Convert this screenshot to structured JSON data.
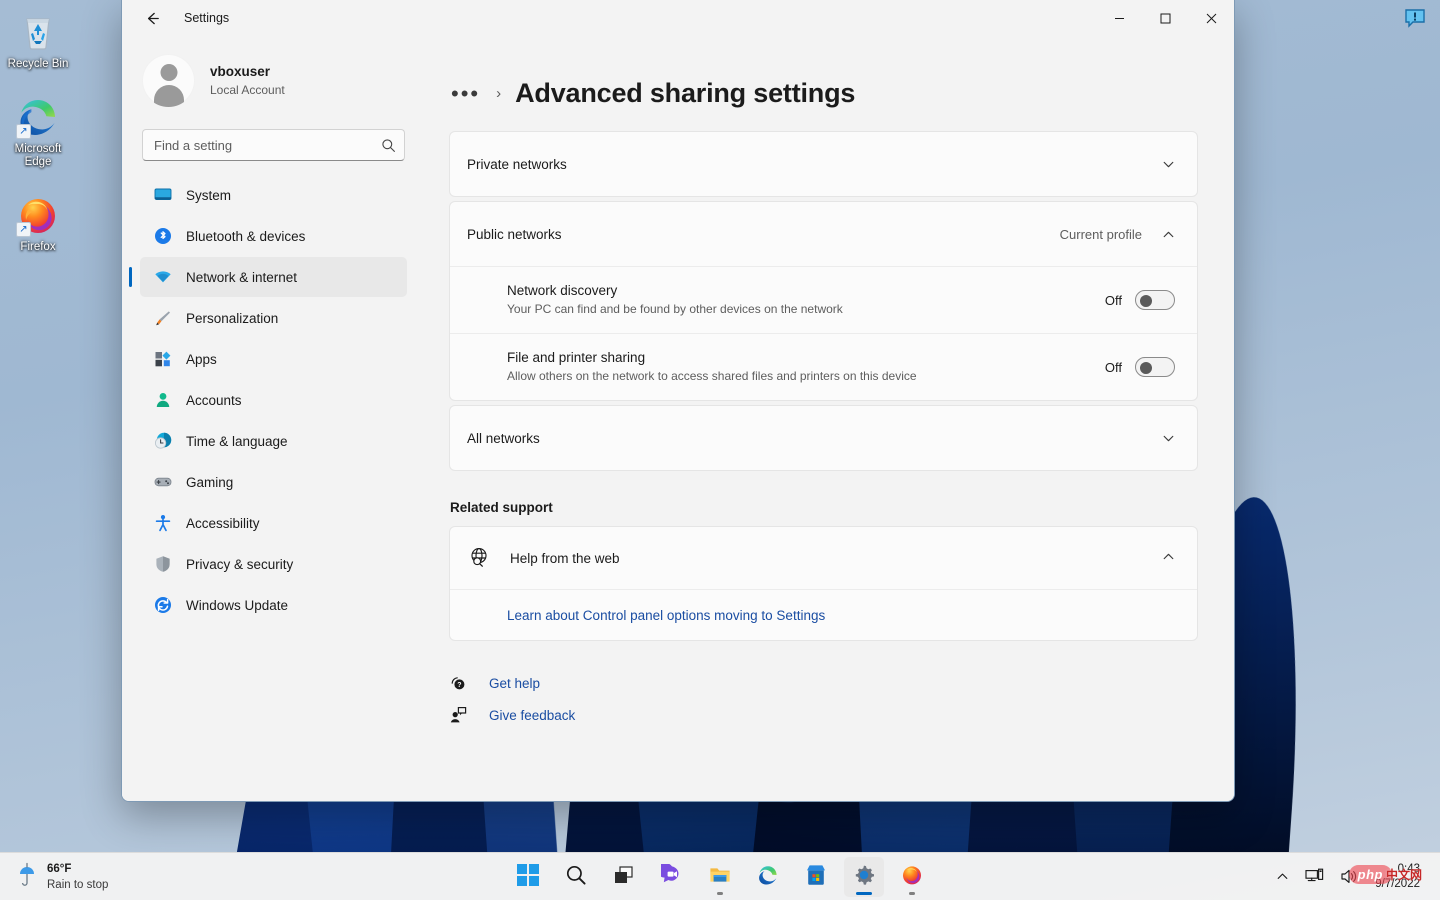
{
  "desktop": {
    "icons": [
      {
        "label": "Recycle Bin",
        "icon": "recycle-bin-icon",
        "shortcut": false
      },
      {
        "label": "Microsoft Edge",
        "icon": "edge-icon",
        "shortcut": true
      },
      {
        "label": "Firefox",
        "icon": "firefox-icon",
        "shortcut": true
      }
    ],
    "notification_balloon": "notification-balloon-icon"
  },
  "window": {
    "title": "Settings",
    "back_icon": "back-arrow-icon",
    "controls": {
      "minimize": "minimize-icon",
      "maximize": "maximize-icon",
      "close": "close-icon"
    }
  },
  "sidebar": {
    "account": {
      "name": "vboxuser",
      "subtitle": "Local Account",
      "avatar": "user-avatar"
    },
    "search": {
      "placeholder": "Find a setting",
      "value": "",
      "icon": "search-icon"
    },
    "items": [
      {
        "label": "System",
        "icon": "system-icon",
        "active": false
      },
      {
        "label": "Bluetooth & devices",
        "icon": "bluetooth-icon",
        "active": false
      },
      {
        "label": "Network & internet",
        "icon": "network-wifi-icon",
        "active": true
      },
      {
        "label": "Personalization",
        "icon": "personalization-brush-icon",
        "active": false
      },
      {
        "label": "Apps",
        "icon": "apps-icon",
        "active": false
      },
      {
        "label": "Accounts",
        "icon": "accounts-person-icon",
        "active": false
      },
      {
        "label": "Time & language",
        "icon": "time-language-clock-icon",
        "active": false
      },
      {
        "label": "Gaming",
        "icon": "gaming-controller-icon",
        "active": false
      },
      {
        "label": "Accessibility",
        "icon": "accessibility-person-icon",
        "active": false
      },
      {
        "label": "Privacy & security",
        "icon": "shield-icon",
        "active": false
      },
      {
        "label": "Windows Update",
        "icon": "windows-update-refresh-icon",
        "active": false
      }
    ]
  },
  "main": {
    "breadcrumb": {
      "overflow": "•••",
      "separator": "›"
    },
    "page_title": "Advanced sharing settings",
    "sections": [
      {
        "title": "Private networks",
        "note": "",
        "expanded": false,
        "chevron": "chevron-down-icon"
      },
      {
        "title": "Public networks",
        "note": "Current profile",
        "expanded": true,
        "chevron": "chevron-up-icon"
      }
    ],
    "public_settings": [
      {
        "title": "Network discovery",
        "description": "Your PC can find and be found by other devices on the network",
        "toggle_state": "Off",
        "toggle_on": false
      },
      {
        "title": "File and printer sharing",
        "description": "Allow others on the network to access shared files and printers on this device",
        "toggle_state": "Off",
        "toggle_on": false
      }
    ],
    "all_networks": {
      "title": "All networks",
      "expanded": false,
      "chevron": "chevron-down-icon"
    },
    "related_support": {
      "label": "Related support",
      "help_from_web": {
        "title": "Help from the web",
        "icon": "globe-search-icon",
        "expanded": true,
        "chevron": "chevron-up-icon"
      },
      "links": [
        {
          "text": "Learn about Control panel options moving to Settings"
        }
      ]
    },
    "footer_links": [
      {
        "text": "Get help",
        "icon": "get-help-icon"
      },
      {
        "text": "Give feedback",
        "icon": "give-feedback-icon"
      }
    ]
  },
  "taskbar": {
    "weather": {
      "temperature": "66°F",
      "condition": "Rain to stop",
      "icon": "umbrella-rain-icon"
    },
    "buttons": [
      {
        "name": "start",
        "label": "Start",
        "icon": "windows-start-icon",
        "active": false,
        "running": false
      },
      {
        "name": "search",
        "label": "Search",
        "icon": "search-icon",
        "active": false,
        "running": false
      },
      {
        "name": "task-view",
        "label": "Task view",
        "icon": "task-view-icon",
        "active": false,
        "running": false
      },
      {
        "name": "chat",
        "label": "Chat",
        "icon": "chat-teams-icon",
        "active": false,
        "running": false
      },
      {
        "name": "file-explorer",
        "label": "File Explorer",
        "icon": "file-explorer-icon",
        "active": false,
        "running": true
      },
      {
        "name": "edge",
        "label": "Microsoft Edge",
        "icon": "edge-icon",
        "active": false,
        "running": false
      },
      {
        "name": "store",
        "label": "Microsoft Store",
        "icon": "microsoft-store-icon",
        "active": false,
        "running": false
      },
      {
        "name": "settings",
        "label": "Settings",
        "icon": "settings-gear-icon",
        "active": true,
        "running": true
      },
      {
        "name": "firefox",
        "label": "Firefox",
        "icon": "firefox-icon",
        "active": false,
        "running": true
      }
    ],
    "tray": {
      "show_hidden": "chevron-up-icon",
      "network": "network-tray-icon",
      "volume": "volume-tray-icon",
      "time": "0:43",
      "date": "9/7/2022"
    },
    "watermark": {
      "badge": "php",
      "text": "中文网"
    }
  }
}
